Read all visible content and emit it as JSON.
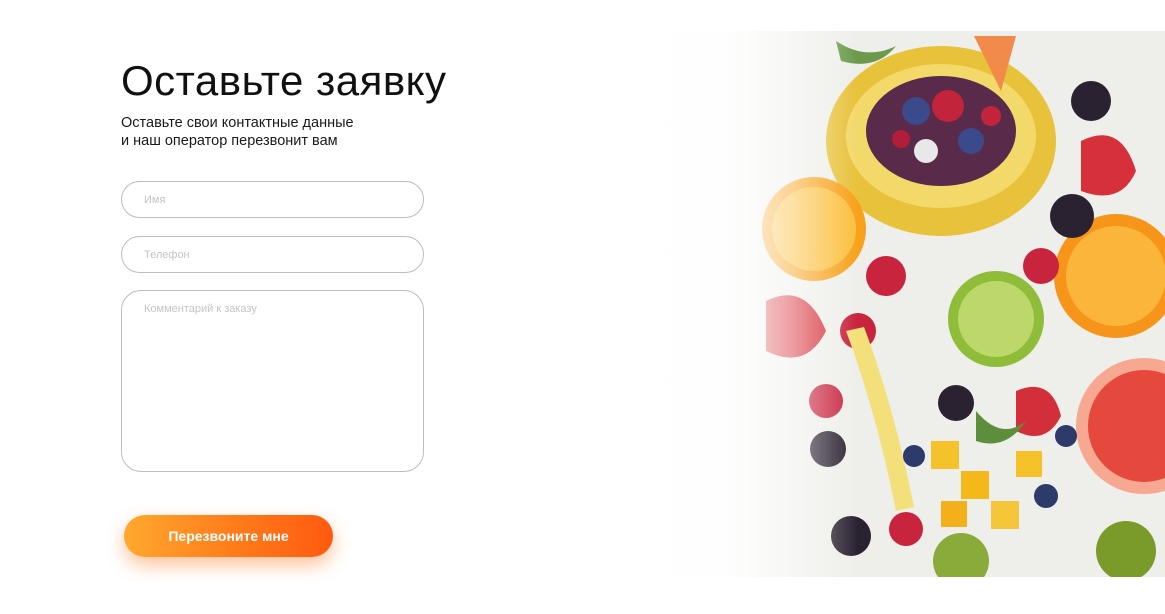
{
  "form": {
    "title": "Оставьте заявку",
    "subtitle_line1": "Оставьте свои контактные данные",
    "subtitle_line2": "и наш оператор перезвонит вам",
    "name_placeholder": "Имя",
    "phone_placeholder": "Телефон",
    "comment_placeholder": "Комментарий к заказу",
    "submit_label": "Перезвоните мне"
  },
  "colors": {
    "accent_start": "#ffa82e",
    "accent_end": "#ff5a0f",
    "input_border": "#bdbdbd",
    "title_text": "#111111"
  }
}
